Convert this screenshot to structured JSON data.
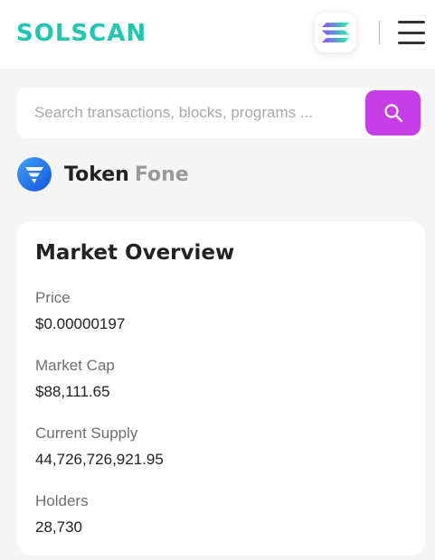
{
  "header": {
    "logo_text": "SOLSCAN",
    "brand_color": "#1fc7b0",
    "network_icon": "solana-icon",
    "menu_icon": "hamburger-menu-icon"
  },
  "search": {
    "placeholder": "Search transactions, blocks, programs ...",
    "value": "",
    "button_icon": "search-icon",
    "button_color": "#c83ee6"
  },
  "token": {
    "prefix": "Token",
    "name": "Fone",
    "icon": "fone-token-logo"
  },
  "market_overview": {
    "title": "Market Overview",
    "fields": [
      {
        "label": "Price",
        "value": "$0.00000197"
      },
      {
        "label": "Market Cap",
        "value": "$88,111.65"
      },
      {
        "label": "Current Supply",
        "value": "44,726,726,921.95"
      },
      {
        "label": "Holders",
        "value": "28,730"
      }
    ]
  }
}
